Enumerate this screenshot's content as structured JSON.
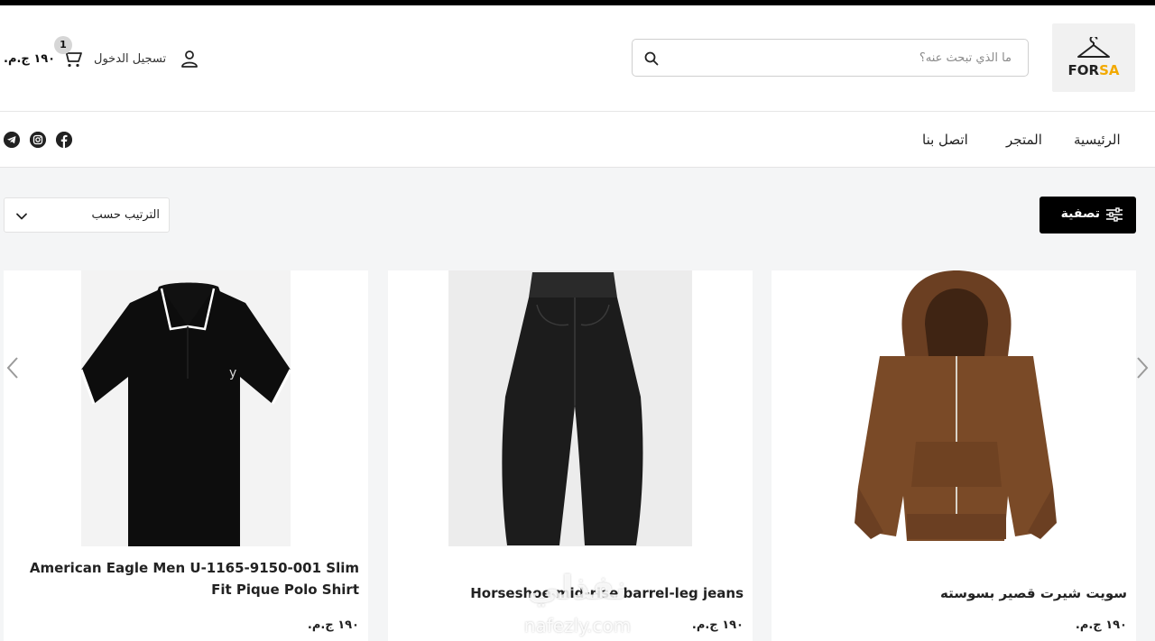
{
  "brand": {
    "logo_main": "FOR",
    "logo_accent": "SA"
  },
  "header": {
    "search_placeholder": "ما الذي تبحث عنه؟",
    "login_label": "تسجيل الدخول",
    "cart_count": "1",
    "cart_price": "١٩٠ ج.م."
  },
  "nav": {
    "items": [
      {
        "label": "الرئيسية"
      },
      {
        "label": "المتجر"
      },
      {
        "label": "اتصل بنا"
      }
    ],
    "social": [
      "facebook-icon",
      "instagram-icon",
      "telegram-icon"
    ]
  },
  "toolbar": {
    "filter_label": "تصفية",
    "sort_label": "الترتيب حسب"
  },
  "products": [
    {
      "name": "سويت شيرت قصير بسوسته",
      "price": "١٩٠ ج.م.",
      "image": "brown-zip-hoodie"
    },
    {
      "name": "Horseshoe mid-rise barrel-leg jeans",
      "price": "١٩٠ ج.م.",
      "image": "black-barrel-jeans"
    },
    {
      "name": "American Eagle Men U-1165-9150-001 Slim Fit Pique Polo Shirt",
      "price": "١٩٠ ج.م.",
      "image": "black-polo-shirt"
    }
  ],
  "watermark": {
    "arabic": "نفذلي",
    "latin": "nafezly.com"
  }
}
